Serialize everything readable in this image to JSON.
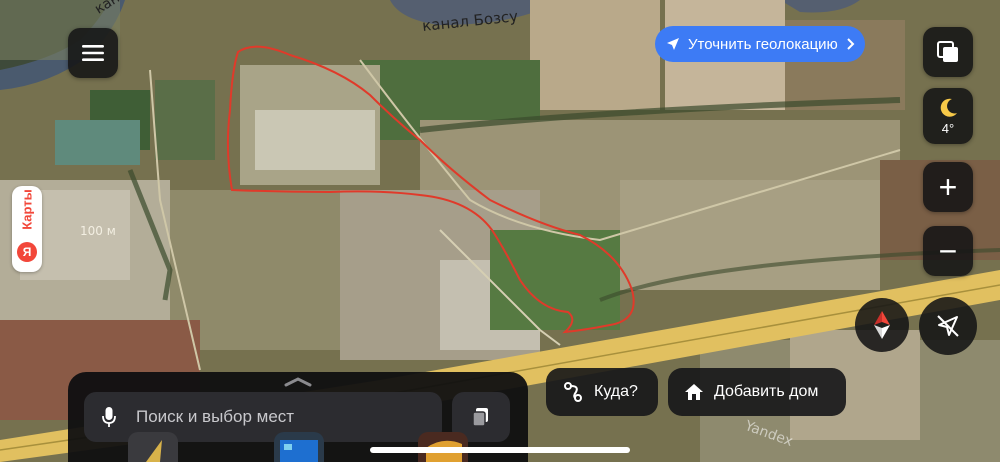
{
  "map": {
    "canal_label_1": "канал Бозсу",
    "canal_label_2": "канал Бозсу",
    "scale_label": "100 м",
    "watermark": "Yandex"
  },
  "geolocation_button": {
    "label": "Уточнить геолокацию"
  },
  "weather": {
    "temperature": "4°",
    "icon": "moon-icon"
  },
  "controls": {
    "layers": "layers-icon",
    "zoom_in": "+",
    "zoom_out": "−",
    "compass": "compass-icon",
    "navigation": "navigation-off-icon"
  },
  "brand_tab": {
    "label": "Карты",
    "logo_letter": "Я"
  },
  "search": {
    "placeholder": "Поиск и выбор мест"
  },
  "actions": {
    "where_to": "Куда?",
    "add_home": "Добавить дом"
  },
  "colors": {
    "route": "#e03a2a",
    "geoloc_accent": "#3d7bf5",
    "road": "#e8c552",
    "brand_red": "#f2473a"
  }
}
